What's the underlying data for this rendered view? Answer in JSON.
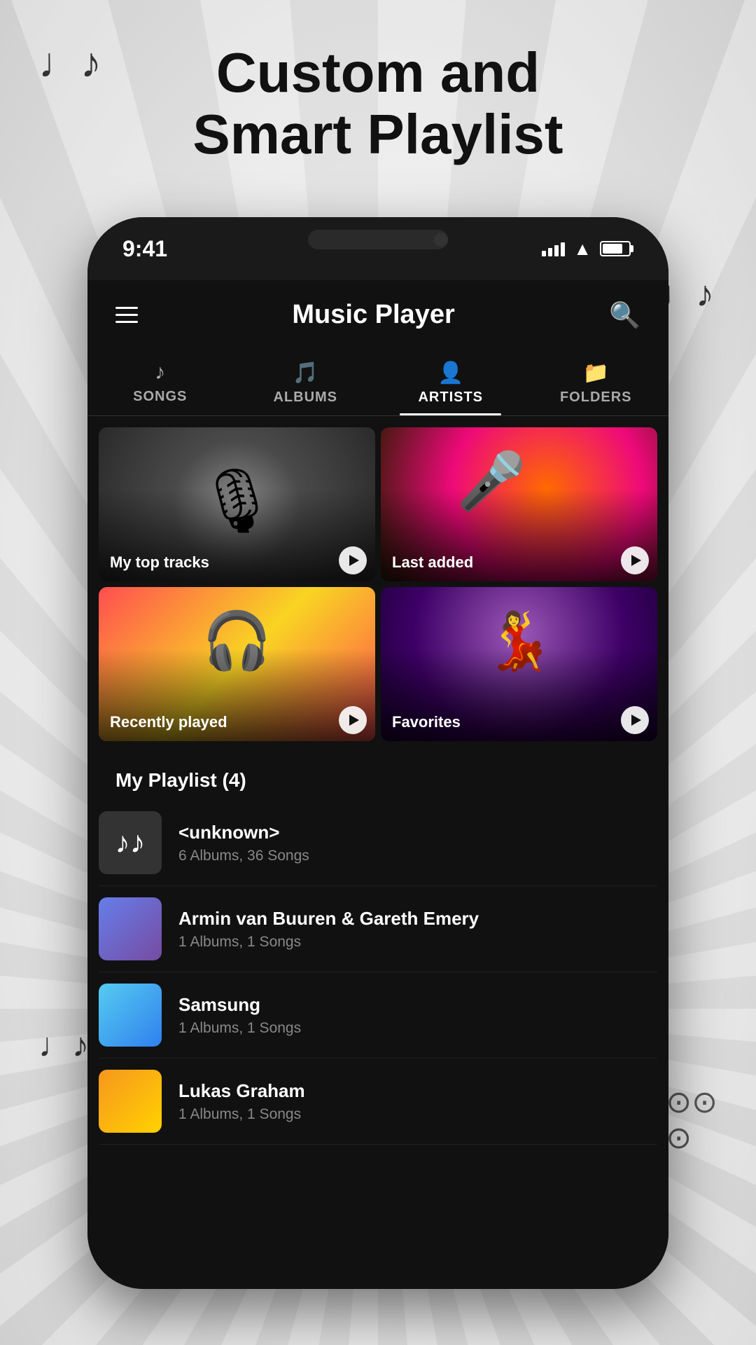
{
  "page": {
    "title_line1": "Custom and",
    "title_line2": "Smart Playlist"
  },
  "status_bar": {
    "time": "9:41"
  },
  "app_header": {
    "title": "Music Player"
  },
  "tabs": [
    {
      "id": "songs",
      "label": "SONGS",
      "icon": "♪",
      "active": false
    },
    {
      "id": "albums",
      "label": "ALBUMS",
      "icon": "💿",
      "active": false
    },
    {
      "id": "artists",
      "label": "ARTISTS",
      "icon": "👤",
      "active": true
    },
    {
      "id": "folders",
      "label": "FOLDERS",
      "icon": "📁",
      "active": false
    }
  ],
  "playlist_cards": [
    {
      "id": "top-tracks",
      "label": "My top tracks",
      "type": "mic"
    },
    {
      "id": "last-added",
      "label": "Last added",
      "type": "concert"
    },
    {
      "id": "recently-played",
      "label": "Recently played",
      "type": "dj"
    },
    {
      "id": "favorites",
      "label": "Favorites",
      "type": "dance"
    }
  ],
  "my_playlist": {
    "section_label": "My Playlist (4)",
    "artists": [
      {
        "id": "unknown",
        "name": "<unknown>",
        "meta": "6 Albums, 36 Songs",
        "thumb_type": "unknown"
      },
      {
        "id": "armin",
        "name": "Armin van Buuren & Gareth Emery",
        "meta": "1 Albums, 1 Songs",
        "thumb_type": "armin"
      },
      {
        "id": "samsung",
        "name": "Samsung",
        "meta": "1 Albums, 1 Songs",
        "thumb_type": "samsung"
      },
      {
        "id": "lukas",
        "name": "Lukas Graham",
        "meta": "1 Albums, 1 Songs",
        "thumb_type": "lukas"
      }
    ]
  }
}
